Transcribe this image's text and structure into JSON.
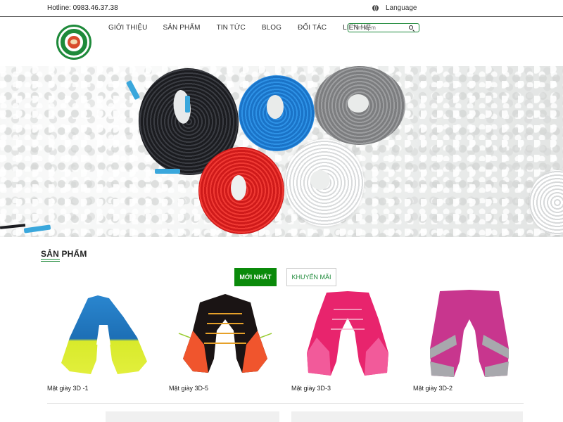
{
  "topbar": {
    "hotline": "Hotline: 0983.46.37.38",
    "language": "Language",
    "language_icon": "globe-icon"
  },
  "header": {
    "logo_text": "THỊNH HOÀNG GIA",
    "nav": [
      "GIỚI THIỆU",
      "SẢN PHẨM",
      "TIN TỨC",
      "BLOG",
      "ĐỐI TÁC",
      "LIÊN HỆ"
    ],
    "search_placeholder": "Tìm kiếm",
    "search_icon": "search-icon",
    "accent_color": "#1e8a3a"
  },
  "products": {
    "title": "SẢN PHẨM",
    "tabs": [
      {
        "label": "MỚI NHẤT",
        "active": true
      },
      {
        "label": "KHUYẾN MÃI",
        "active": false
      }
    ],
    "items": [
      {
        "name": "Mặt giày 3D -1",
        "colors": [
          "#1d6fb5",
          "#d8ea2b"
        ]
      },
      {
        "name": "Mặt giày 3D-5",
        "colors": [
          "#1a1414",
          "#f0552d"
        ]
      },
      {
        "name": "Mặt giày 3D-3",
        "colors": [
          "#e8246d",
          "#f25a9a"
        ]
      },
      {
        "name": "Mặt giày 3D-2",
        "colors": [
          "#c8368e",
          "#a8a8ad"
        ]
      }
    ]
  }
}
